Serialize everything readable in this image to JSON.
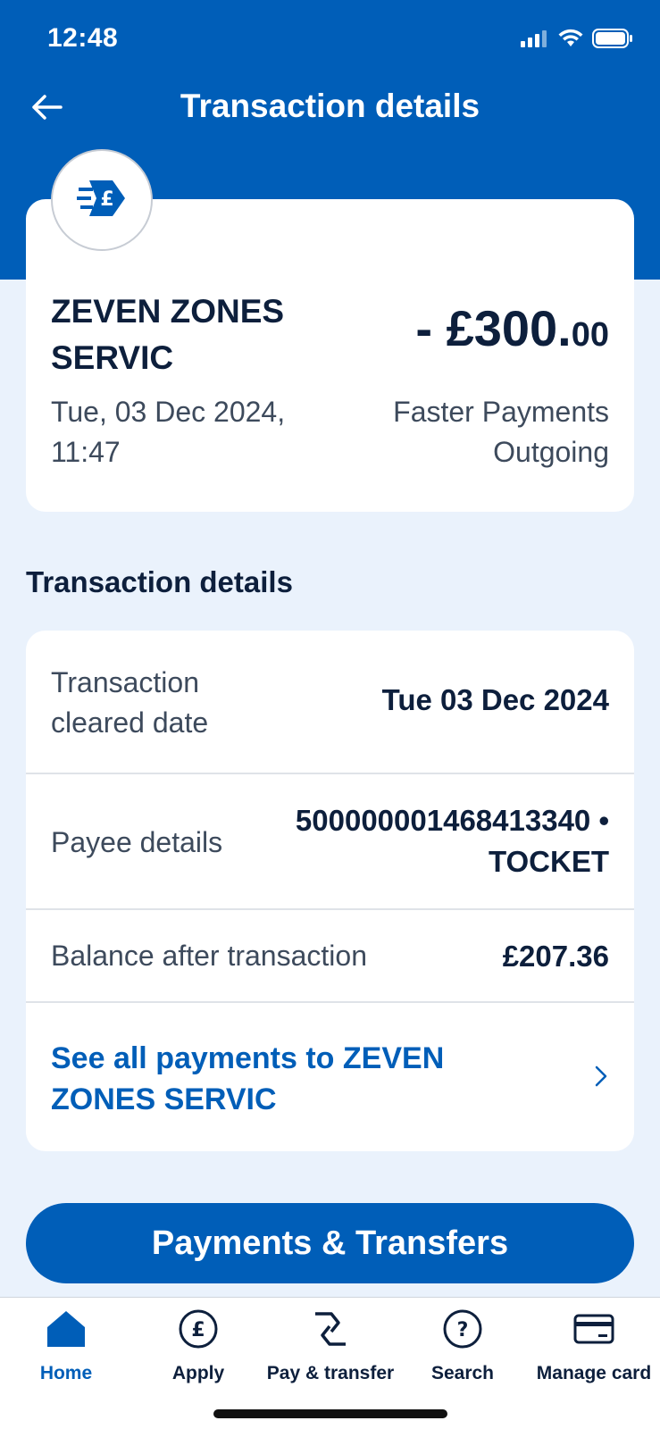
{
  "status_bar": {
    "time": "12:48"
  },
  "header": {
    "title": "Transaction details",
    "back_icon": "arrow-left-icon"
  },
  "summary": {
    "merchant_icon": "faster-payment-pound-icon",
    "merchant_name": "ZEVEN ZONES SERVIC",
    "datetime": "Tue, 03 Dec 2024, 11:47",
    "amount_main": "- £300.",
    "amount_pence": "00",
    "payment_type": "Faster Payments Outgoing"
  },
  "details": {
    "section_title": "Transaction details",
    "rows": [
      {
        "label": "Transaction cleared date",
        "value": "Tue 03 Dec 2024"
      },
      {
        "label": "Payee details",
        "value": "500000001468413340 • TOCKET"
      },
      {
        "label": "Balance after transaction",
        "value": "£207.36"
      }
    ],
    "link_text": "See all payments to ZEVEN ZONES SERVIC"
  },
  "primary_button": {
    "label": "Payments & Transfers"
  },
  "tabbar": {
    "active": "Home",
    "tabs": [
      {
        "label": "Home",
        "icon": "home-icon"
      },
      {
        "label": "Apply",
        "icon": "pound-circle-icon"
      },
      {
        "label": "Pay & transfer",
        "icon": "pay-transfer-icon"
      },
      {
        "label": "Search",
        "icon": "question-circle-icon"
      },
      {
        "label": "Manage card",
        "icon": "card-icon"
      }
    ]
  },
  "colors": {
    "brand": "#005eb8",
    "background": "#eaf2fc",
    "text": "#0d1f3c"
  }
}
